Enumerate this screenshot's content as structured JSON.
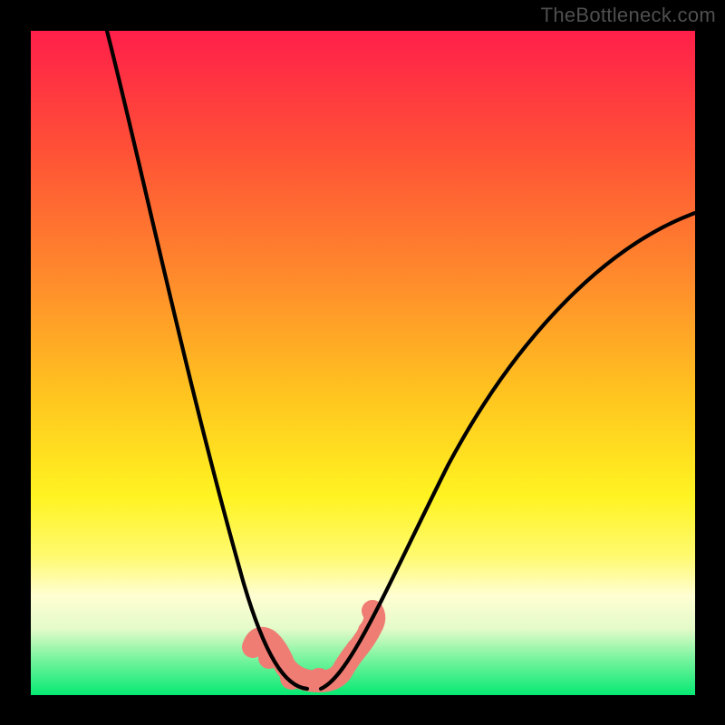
{
  "attribution": "TheBottleneck.com",
  "colors": {
    "frame": "#000000",
    "gradient_top": "#ff1f4a",
    "gradient_bottom": "#06e973",
    "curve": "#000000",
    "beads": "#ef7d74",
    "attribution_text": "#4f4f4f"
  },
  "chart_data": {
    "type": "line",
    "title": "",
    "xlabel": "",
    "ylabel": "",
    "xlim": [
      0,
      100
    ],
    "ylim": [
      0,
      100
    ],
    "series": [
      {
        "name": "left-branch",
        "x": [
          11,
          15,
          20,
          25,
          30,
          34,
          38,
          41
        ],
        "values": [
          100,
          80,
          60,
          40,
          22,
          10,
          3,
          1
        ]
      },
      {
        "name": "right-branch",
        "x": [
          44,
          48,
          55,
          63,
          72,
          82,
          92,
          100
        ],
        "values": [
          1,
          6,
          18,
          34,
          50,
          62,
          70,
          73
        ]
      },
      {
        "name": "beads",
        "x": [
          35,
          36,
          39,
          43,
          47,
          49,
          51,
          52
        ],
        "values": [
          8,
          6,
          2,
          2,
          4,
          7,
          9,
          12
        ]
      }
    ],
    "background": "vertical-gradient red→orange→yellow→green",
    "grid": false,
    "legend": false
  }
}
